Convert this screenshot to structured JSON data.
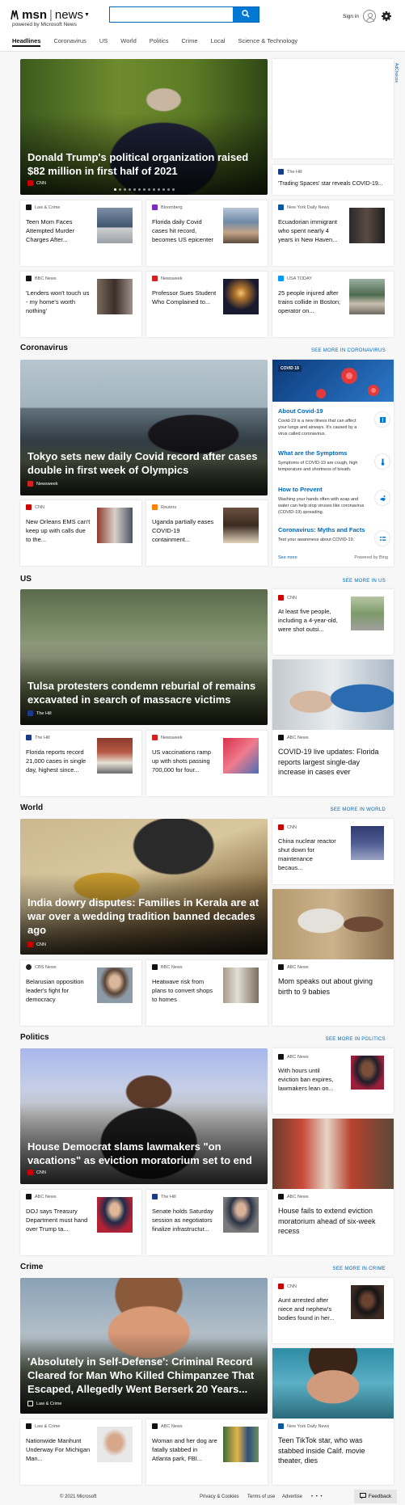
{
  "header": {
    "brand": "msn",
    "section": "news",
    "powered_by": "powered by Microsoft News",
    "search_placeholder": "",
    "sign_in": "Sign in"
  },
  "nav": [
    "Headlines",
    "Coronavirus",
    "US",
    "World",
    "Politics",
    "Crime",
    "Local",
    "Science & Technology"
  ],
  "top": {
    "hero": {
      "title": "Donald Trump's political organization raised $82 million in first half of 2021",
      "source": "CNN"
    },
    "adchoices": "AdChoices",
    "side": {
      "source": "The Hill",
      "title": "'Trading Spaces' star reveals COVID-19..."
    },
    "row1": [
      {
        "source": "Law & Crime",
        "title": "Teen Mom Faces Attempted Murder Charges After..."
      },
      {
        "source": "Bloomberg",
        "title": "Florida daily Covid cases hit record, becomes US epicenter"
      },
      {
        "source": "New York Daily News",
        "title": "Ecuadorian immigrant who spent nearly 4 years in New Haven..."
      }
    ],
    "row2": [
      {
        "source": "BBC News",
        "title": "'Lenders won't touch us - my home's worth nothing'"
      },
      {
        "source": "Newsweek",
        "title": "Professor Sues Student Who Complained to..."
      },
      {
        "source": "USA TODAY",
        "title": "25 people injured after trains collide in Boston; operator on..."
      }
    ]
  },
  "coronavirus": {
    "heading": "Coronavirus",
    "more": "SEE MORE IN CORONAVIRUS",
    "hero": {
      "title": "Tokyo sets new daily Covid record after cases double in first week of Olympics",
      "source": "Newsweek"
    },
    "row": [
      {
        "source": "CNN",
        "title": "New Orleans EMS can't keep up with calls due to the..."
      },
      {
        "source": "Reuters",
        "title": "Uganda partially eases COVID-19 containment..."
      }
    ],
    "info": {
      "tag": "COVID 19",
      "items": [
        {
          "title": "About Covid-19",
          "body": "Covid-19 is a new illness that can affect your lungs and airways. It's caused by a virus called coronavirus."
        },
        {
          "title": "What are the Symptoms",
          "body": "Symptoms of COVID-19 are cough, high temperature and shortness of breath."
        },
        {
          "title": "How to Prevent",
          "body": "Washing your hands often with soap and water can help stop viruses like coronavirus (COVID-19) spreading."
        },
        {
          "title": "Coronavirus: Myths and Facts",
          "body": "Test your awareness about COVID-19."
        }
      ],
      "see_more": "See more",
      "powered": "Powered by Bing"
    }
  },
  "us": {
    "heading": "US",
    "more": "SEE MORE IN US",
    "hero": {
      "title": "Tulsa protesters condemn reburial of remains excavated in search of massacre victims",
      "source": "The Hill"
    },
    "side_small": {
      "source": "CNN",
      "title": "At least five people, including a 4-year-old, were shot outsi..."
    },
    "side_large": {
      "source": "ABC News",
      "title": "COVID-19 live updates: Florida reports largest single-day increase in cases ever"
    },
    "row": [
      {
        "source": "The Hill",
        "title": "Florida reports record 21,000 cases in single day, highest since..."
      },
      {
        "source": "Newsweek",
        "title": "US vaccinations ramp up with shots passing 700,000 for four..."
      }
    ]
  },
  "world": {
    "heading": "World",
    "more": "SEE MORE IN WORLD",
    "hero": {
      "title": "India dowry disputes: Families in Kerala are at war over a wedding tradition banned decades ago",
      "source": "CNN"
    },
    "side_small": {
      "source": "CNN",
      "title": "China nuclear reactor shut down for maintenance becaus..."
    },
    "side_large": {
      "source": "ABC News",
      "title": "Mom speaks out about giving birth to 9 babies"
    },
    "row": [
      {
        "source": "CBS News",
        "title": "Belarusian opposition leader's fight for democracy"
      },
      {
        "source": "BBC News",
        "title": "Heatwave risk from plans to convert shops to homes"
      }
    ]
  },
  "politics": {
    "heading": "Politics",
    "more": "SEE MORE IN POLITICS",
    "hero": {
      "title": "House Democrat slams lawmakers \"on vacations\" as eviction moratorium set to end",
      "source": "CNN"
    },
    "side_small": {
      "source": "ABC News",
      "title": "With hours until eviction ban expires, lawmakers lean on..."
    },
    "side_large": {
      "source": "ABC News",
      "title": "House fails to extend eviction moratorium ahead of six-week recess"
    },
    "row": [
      {
        "source": "ABC News",
        "title": "DOJ says Treasury Department must hand over Trump ta..."
      },
      {
        "source": "The Hill",
        "title": "Senate holds Saturday session as negotiators finalize infrastructur..."
      }
    ]
  },
  "crime": {
    "heading": "Crime",
    "more": "SEE MORE IN CRIME",
    "hero": {
      "title": "'Absolutely in Self-Defense': Criminal Record Cleared for Man Who Killed Chimpanzee That Escaped, Allegedly Went Berserk 20 Years...",
      "source": "Law & Crime"
    },
    "side_small": {
      "source": "CNN",
      "title": "Aunt arrested after niece and nephew's bodies found in her..."
    },
    "side_large": {
      "source": "New York Daily News",
      "title": "Teen TikTok star, who was stabbed inside Calif. movie theater, dies"
    },
    "row": [
      {
        "source": "Law & Crime",
        "title": "Nationwide Manhunt Underway For Michigan Man..."
      },
      {
        "source": "ABC News",
        "title": "Woman and her dog are fatally stabbed in Atlanta park, FBI..."
      }
    ]
  },
  "footer": {
    "copyright": "© 2021 Microsoft",
    "links": [
      "Privacy & Cookies",
      "Terms of use",
      "Advertise"
    ],
    "more": "• • •",
    "feedback": "Feedback"
  },
  "colors": {
    "accent": "#0078d4",
    "link": "#0067b8",
    "cnn": "#cc0000",
    "newsweek": "#d41f1f",
    "thehill": "#1a3a8a"
  }
}
